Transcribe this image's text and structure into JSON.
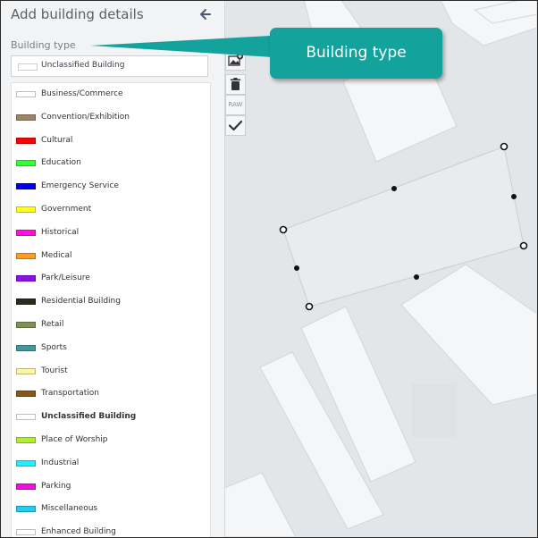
{
  "panel": {
    "title": "Add building details",
    "back_icon": "arrow-left-icon",
    "building_type_label": "Building type",
    "selected": {
      "label": "Unclassified Building",
      "color": "#ffffff"
    }
  },
  "building_types": [
    {
      "label": "Business/Commerce",
      "color": "#ffffff",
      "selected": false
    },
    {
      "label": "Convention/Exhibition",
      "color": "#9c8468",
      "selected": false
    },
    {
      "label": "Cultural",
      "color": "#ff0000",
      "selected": false
    },
    {
      "label": "Education",
      "color": "#33ff33",
      "selected": false
    },
    {
      "label": "Emergency Service",
      "color": "#0000ee",
      "selected": false
    },
    {
      "label": "Government",
      "color": "#ffff22",
      "selected": false
    },
    {
      "label": "Historical",
      "color": "#ff11dd",
      "selected": false
    },
    {
      "label": "Medical",
      "color": "#ff9a22",
      "selected": false
    },
    {
      "label": "Park/Leisure",
      "color": "#8a11ee",
      "selected": false
    },
    {
      "label": "Residential Building",
      "color": "#2a2a1e",
      "selected": false
    },
    {
      "label": "Retail",
      "color": "#7f9155",
      "selected": false
    },
    {
      "label": "Sports",
      "color": "#47979a",
      "selected": false
    },
    {
      "label": "Tourist",
      "color": "#fbf6a6",
      "selected": false
    },
    {
      "label": "Transportation",
      "color": "#8a5515",
      "selected": false
    },
    {
      "label": "Unclassified Building",
      "color": "#ffffff",
      "selected": true
    },
    {
      "label": "Place of Worship",
      "color": "#b1ee33",
      "selected": false
    },
    {
      "label": "Industrial",
      "color": "#22eeff",
      "selected": false
    },
    {
      "label": "Parking",
      "color": "#ee11dd",
      "selected": false
    },
    {
      "label": "Miscellaneous",
      "color": "#22ccee",
      "selected": false
    },
    {
      "label": "Enhanced Building",
      "color": "#ffffff",
      "selected": false
    }
  ],
  "toolbar": {
    "add_image_icon": "add-image-icon",
    "delete_icon": "trash-icon",
    "raw_label": "RAW",
    "confirm_icon": "checkmark-icon"
  },
  "callout": {
    "text": "Building type",
    "color": "#14a29c"
  },
  "map": {
    "background": "#e3e6e9",
    "building_fill": "#f5f6f7"
  }
}
